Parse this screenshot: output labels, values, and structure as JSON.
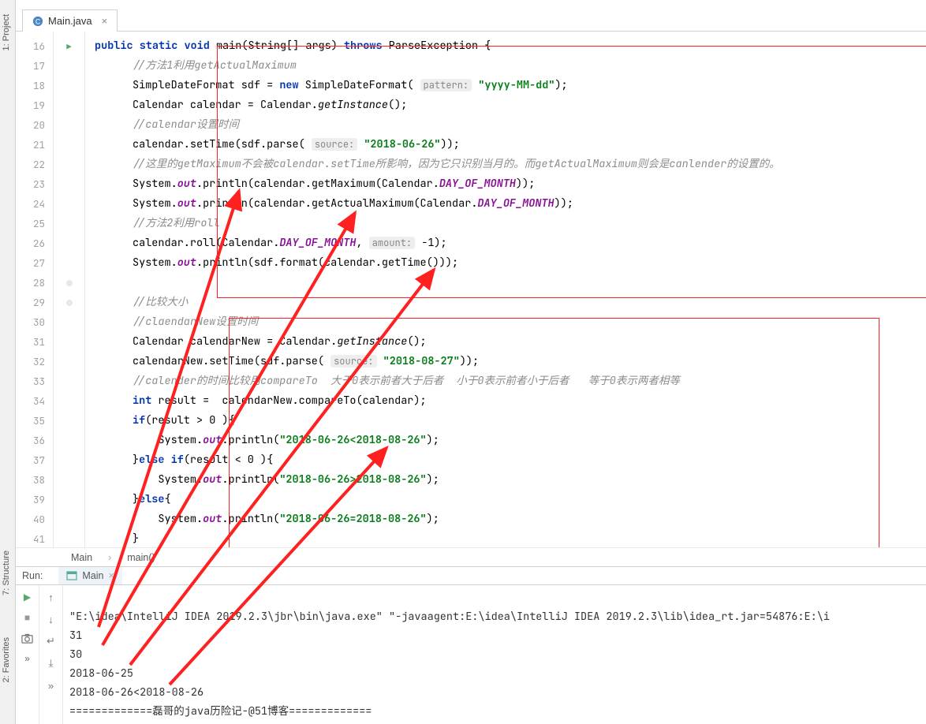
{
  "file_tab": {
    "name": "Main.java"
  },
  "sidebar": {
    "project": "1: Project",
    "structure": "7: Structure",
    "favorites": "2: Favorites"
  },
  "lines": [
    {
      "n": 16
    },
    {
      "n": 17
    },
    {
      "n": 18
    },
    {
      "n": 19
    },
    {
      "n": 20
    },
    {
      "n": 21
    },
    {
      "n": 22
    },
    {
      "n": 23
    },
    {
      "n": 24
    },
    {
      "n": 25
    },
    {
      "n": 26
    },
    {
      "n": 27
    },
    {
      "n": 28
    },
    {
      "n": 29
    },
    {
      "n": 30
    },
    {
      "n": 31
    },
    {
      "n": 32
    },
    {
      "n": 33
    },
    {
      "n": 34
    },
    {
      "n": 35
    },
    {
      "n": 36
    },
    {
      "n": 37
    },
    {
      "n": 38
    },
    {
      "n": 39
    },
    {
      "n": 40
    },
    {
      "n": 41
    }
  ],
  "code": {
    "l16": {
      "p1": "public",
      "p2": "static",
      "p3": "void",
      "p4": " main(String[] args) ",
      "p5": "throws",
      "p6": " ParseException {"
    },
    "l17": "//方法1利用getActualMaximum",
    "l18": {
      "a": "SimpleDateFormat sdf = ",
      "n": "new",
      "b": " SimpleDateFormat( ",
      "h": "pattern:",
      "s": "\"yyyy-MM-dd\"",
      "e": ");"
    },
    "l19": {
      "a": "Calendar calendar = Calendar.",
      "m": "getInstance",
      "e": "();"
    },
    "l20": "//calendar设置时间",
    "l21": {
      "a": "calendar.setTime(sdf.parse( ",
      "h": "source:",
      "s": "\"2018-06-26\"",
      "e": "));"
    },
    "l22": "//这里的getMaximum不会被calendar.setTime所影响，因为它只识别当月的。而getActualMaximum则会是canlender的设置的。",
    "l23": {
      "a": "System.",
      "o": "out",
      "b": ".println(calendar.getMaximum(Calendar.",
      "c": "DAY_OF_MONTH",
      "e": "));"
    },
    "l24": {
      "a": "System.",
      "o": "out",
      "b": ".println(calendar.getActualMaximum(Calendar.",
      "c": "DAY_OF_MONTH",
      "e": "));"
    },
    "l25": "//方法2利用roll",
    "l26": {
      "a": "calendar.roll(Calendar.",
      "c": "DAY_OF_MONTH",
      "b": ", ",
      "h": "amount:",
      "v": " -1);"
    },
    "l27": {
      "a": "System.",
      "o": "out",
      "b": ".println(sdf.format(calendar.getTime()));"
    },
    "l29": "//比较大小",
    "l30": "//claendarNew设置时间",
    "l31": {
      "a": "Calendar calendarNew = Calendar.",
      "m": "getInstance",
      "e": "();"
    },
    "l32": {
      "a": "calendarNew.setTime(sdf.parse( ",
      "h": "source:",
      "s": "\"2018-08-27\"",
      "e": "));"
    },
    "l33": "//calender的时间比较用compareTo  大于0表示前者大于后者  小于0表示前者小于后者   等于0表示两者相等",
    "l34": {
      "k": "int",
      "a": " result =  calendarNew.compareTo(calendar);"
    },
    "l35": {
      "k": "if",
      "a": "(result > 0 ){"
    },
    "l36": {
      "a": "    System.",
      "o": "out",
      "b": ".println(",
      "s": "\"2018-06-26<2018-08-26\"",
      "e": ");"
    },
    "l37": {
      "a": "}",
      "k": "else if",
      "b": "(result < 0 ){"
    },
    "l38": {
      "a": "    System.",
      "o": "out",
      "b": ".println(",
      "s": "\"2018-06-26>2018-08-26\"",
      "e": ");"
    },
    "l39": {
      "a": "}",
      "k": "else",
      "b": "{"
    },
    "l40": {
      "a": "    System.",
      "o": "out",
      "b": ".println(",
      "s": "\"2018-06-26=2018-08-26\"",
      "e": ");"
    },
    "l41": "}"
  },
  "breadcrumb": {
    "a": "Main",
    "b": "main()"
  },
  "run": {
    "label": "Run:",
    "tab": "Main",
    "cmd": "\"E:\\idea\\IntelliJ IDEA 2019.2.3\\jbr\\bin\\java.exe\" \"-javaagent:E:\\idea\\IntelliJ IDEA 2019.2.3\\lib\\idea_rt.jar=54876:E:\\i",
    "out1": "31",
    "out2": "30",
    "out3": "2018-06-25",
    "out4": "2018-06-26<2018-08-26",
    "out5": "=============磊哥的java历险记-@51博客============="
  }
}
